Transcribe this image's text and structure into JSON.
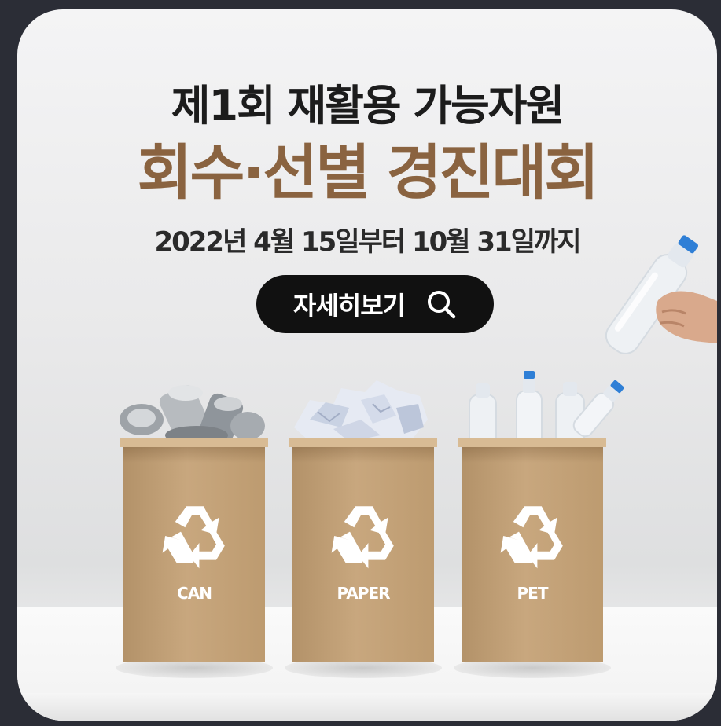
{
  "banner": {
    "title_line1": "제1회 재활용 가능자원",
    "title_line2": "회수·선별 경진대회",
    "period": "2022년 4월 15일부터 10월 31일까지",
    "cta_label": "자세히보기",
    "cta_icon": "search-icon",
    "accent_color": "#8a6340"
  },
  "bins": [
    {
      "label": "CAN",
      "icon": "recycle-icon",
      "contents": "crushed-cans"
    },
    {
      "label": "PAPER",
      "icon": "recycle-icon",
      "contents": "crumpled-paper"
    },
    {
      "label": "PET",
      "icon": "recycle-icon",
      "contents": "plastic-bottles"
    }
  ]
}
